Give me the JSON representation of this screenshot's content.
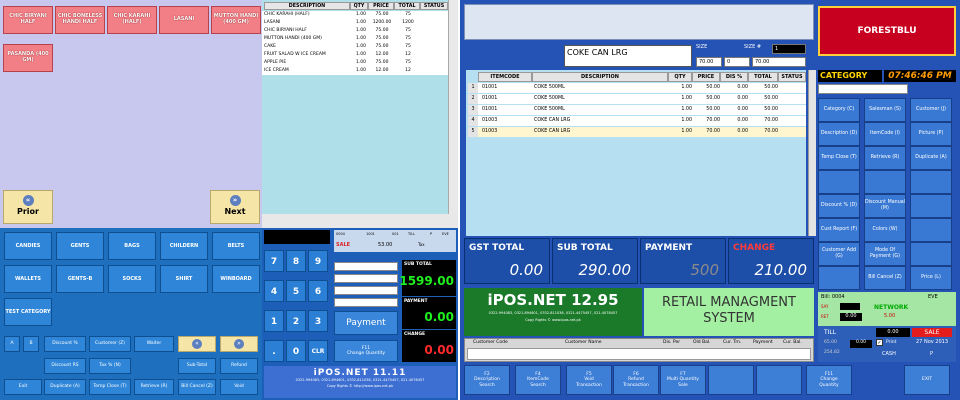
{
  "left_pos": {
    "menu_items": [
      "CHIC BIRYANI HALF",
      "CHIC BONELESS HANDI HALF",
      "CHIC KARAHI (HALF)",
      "LASANI",
      "MUTTON HANDI (400 GM)",
      "PASANDA (400 GM)"
    ],
    "prior_label": "Prior",
    "next_label": "Next",
    "categories": [
      "CANDIES",
      "GENTS",
      "BAGS",
      "CHILDERN",
      "BELTS",
      "WALLETS",
      "GENTS-B",
      "SOCKS",
      "SHIRT",
      "WINBOARD",
      "TEST CATEGORY"
    ],
    "bottom_buttons": [
      "A",
      "B",
      "Discount %",
      "Customer (Z)",
      "Waiter",
      "Sub-Total",
      "Refund",
      "Discount RS",
      "Tax % (N)",
      "Exit",
      "Duplicate (A)",
      "Temp Close (T)",
      "Retrieve (R)",
      "Bill Cancel (Z)",
      "Void"
    ]
  },
  "mid_pos": {
    "columns": [
      "DESCRIPTION",
      "QTY",
      "PRICE",
      "TOTAL",
      "STATUS"
    ],
    "rows": [
      [
        "CHIC KARAHI (HALF)",
        "1.00",
        "75.00",
        "75",
        ""
      ],
      [
        "LASANI",
        "1.00",
        "1200.00",
        "1200",
        ""
      ],
      [
        "CHIC BIRYANI HALF",
        "1.00",
        "75.00",
        "75",
        ""
      ],
      [
        "MUTTON HANDI (400 GM)",
        "1.00",
        "75.00",
        "75",
        ""
      ],
      [
        "CAKE",
        "1.00",
        "75.00",
        "75",
        ""
      ],
      [
        "FRUIT SALAD W ICE CREAM",
        "1.00",
        "12.00",
        "12",
        ""
      ],
      [
        "APPLE PIE",
        "1.00",
        "75.00",
        "75",
        ""
      ],
      [
        "ICE CREAM",
        "1.00",
        "12.00",
        "12",
        ""
      ]
    ],
    "info_small": [
      "0004",
      "1001",
      "001",
      "TILL",
      "P",
      "EVE"
    ],
    "sale_label": "SALE",
    "sale_value": "53.00",
    "tax_label": "Tax",
    "keypad": [
      "7",
      "8",
      "9",
      "4",
      "5",
      "6",
      "1",
      "2",
      "3",
      ".",
      "0",
      "CLR"
    ],
    "sub_total_label": "SUB TOTAL",
    "sub_total_value": "1599.00",
    "payment_label": "PAYMENT",
    "payment_value": "0.00",
    "change_label": "CHANGE",
    "change_value": "0.00",
    "payment_button": "Payment",
    "change_qty_button": "F11\nChange Quantity",
    "brand": "iPOS.NET 11.11",
    "brand_phones": "0322-994083, 0321-894601, 0332-811038, 0321-4475457, 021-4078457",
    "brand_copyright": "Copy Rights © http://www.ipos.net.pk"
  },
  "right_app": {
    "item_name": "COKE CAN LRG",
    "size_label": "SIZE",
    "size_no_label": "SIZE #",
    "size_no_value": "1",
    "price_boxes": [
      "70.00",
      "0",
      "70.00"
    ],
    "columns": [
      "ITEMCODE",
      "DESCRIPTION",
      "QTY",
      "PRICE",
      "DIS %",
      "TOTAL",
      "STATUS"
    ],
    "rows": [
      [
        "1",
        "01001",
        "COKE 500ML",
        "1.00",
        "50.00",
        "0.00",
        "50.00",
        ""
      ],
      [
        "2",
        "01001",
        "COKE 500ML",
        "1.00",
        "50.00",
        "0.00",
        "50.00",
        ""
      ],
      [
        "3",
        "01001",
        "COKE 500ML",
        "1.00",
        "50.00",
        "0.00",
        "50.00",
        ""
      ],
      [
        "4",
        "01003",
        "COKE CAN LRG",
        "1.00",
        "70.00",
        "0.00",
        "70.00",
        ""
      ],
      [
        "5",
        "01003",
        "COKE CAN LRG",
        "1.00",
        "70.00",
        "0.00",
        "70.00",
        ""
      ]
    ],
    "gst_label": "GST TOTAL",
    "gst_value": "0.00",
    "sub_label": "SUB TOTAL",
    "sub_value": "290.00",
    "payment_label": "PAYMENT",
    "payment_value": "500",
    "change_label": "CHANGE",
    "change_value": "210.00",
    "brand": "iPOS.NET 12.95",
    "brand_phones": "0322-994083, 0321-894601, 0332-811038, 0321-4475457, 021-4078457",
    "brand_copyright": "Copy Rights © www.ipos.net.pk",
    "retail_title": "RETAIL MANAGMENT SYSTEM",
    "customer_cols": [
      "Customer Code",
      "Customer Name",
      "Dis. Per",
      "Old Bal.",
      "Cur. Trn.",
      "Payment",
      "Cur. Bal."
    ],
    "company": "FORESTBLU",
    "category_label": "CATEGORY",
    "clock": "07:46:46 PM",
    "side_buttons": [
      "Category (C)",
      "Salesman (S)",
      "Customer (J)",
      "Description (D)",
      "ItemCode (I)",
      "Picture (P)",
      "Temp Close (T)",
      "Retrieve (R)",
      "Duplicate (A)",
      "Discount % (D)",
      "Discount Manual (M)",
      "Cust Report (F)",
      "Colors (W)",
      "Customer Add (G)",
      "Mode Of Payment (G)",
      "Bill Cancel (Z)",
      "Price (L)"
    ],
    "bill_label": "Bill: 0004",
    "eve": "EVE",
    "network": "NETWORK",
    "say_label": "SAY",
    "say_value": "0.00",
    "ret_label": "RET",
    "ret_value": "5.00",
    "till_label": "TILL",
    "till_small": [
      "65.00",
      "254.82"
    ],
    "till_value": "0.00",
    "sale_label": "SALE",
    "print_label": "Print",
    "date": "27 Nov 2013",
    "cash_label": "CASH",
    "p_label": "P",
    "fkeys": [
      "F2\nDescription\nSearch",
      "F4\nItemCode\nSearch",
      "F5\nVoid\nTransaction",
      "F6\nRefund\nTransaction",
      "F7\nMulti Quantity\nSale",
      "",
      "",
      "F11\nChange\nQuantity",
      "EXIT"
    ]
  }
}
